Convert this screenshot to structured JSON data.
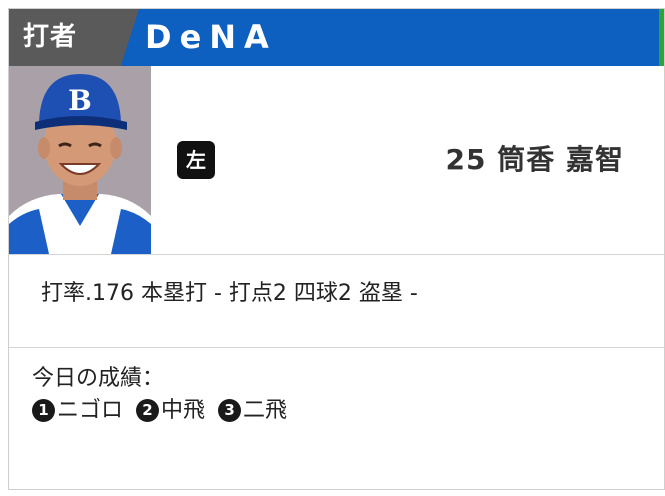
{
  "header": {
    "label": "打者",
    "team": "DeNA"
  },
  "player": {
    "batting_hand": "左",
    "number_name": "25 筒香 嘉智"
  },
  "stats": {
    "text": "打率.176 本塁打 - 打点2 四球2 盗塁 -"
  },
  "today": {
    "label": "今日の成績：",
    "results": [
      {
        "num": "1",
        "text": "ニゴロ"
      },
      {
        "num": "2",
        "text": "中飛"
      },
      {
        "num": "3",
        "text": "二飛"
      }
    ]
  },
  "colors": {
    "header_blue": "#0d5fc0",
    "label_gray": "#5a5a5a",
    "edge_green": "#2ca43c"
  }
}
